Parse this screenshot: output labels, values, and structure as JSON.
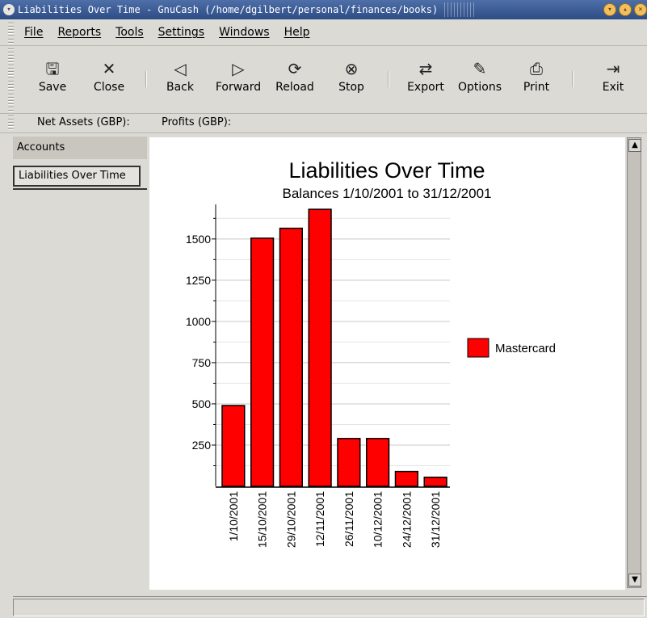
{
  "window": {
    "title": "Liabilities Over Time - GnuCash (/home/dgilbert/personal/finances/books)"
  },
  "menubar": {
    "items": [
      "File",
      "Reports",
      "Tools",
      "Settings",
      "Windows",
      "Help"
    ]
  },
  "toolbar": {
    "save": {
      "label": "Save",
      "icon": "floppy-disk-icon"
    },
    "close": {
      "label": "Close",
      "icon": "close-x-icon"
    },
    "back": {
      "label": "Back",
      "icon": "triangle-left-icon"
    },
    "forward": {
      "label": "Forward",
      "icon": "triangle-right-icon"
    },
    "reload": {
      "label": "Reload",
      "icon": "reload-icon"
    },
    "stop": {
      "label": "Stop",
      "icon": "stop-icon"
    },
    "export": {
      "label": "Export",
      "icon": "export-icon"
    },
    "options": {
      "label": "Options",
      "icon": "options-icon"
    },
    "print": {
      "label": "Print",
      "icon": "printer-icon"
    },
    "exit": {
      "label": "Exit",
      "icon": "exit-icon"
    }
  },
  "summary": {
    "net_assets": "Net Assets (GBP):",
    "profits": "Profits (GBP):"
  },
  "tabs": {
    "accounts": "Accounts",
    "liabilities": "Liabilities Over Time"
  },
  "colors": {
    "bar": "#ff0000",
    "titlebar": "#2d4c86"
  },
  "chart_data": {
    "type": "bar",
    "title": "Liabilities Over Time",
    "subtitle": "Balances 1/10/2001 to 31/12/2001",
    "categories": [
      "1/10/2001",
      "15/10/2001",
      "29/10/2001",
      "12/11/2001",
      "26/11/2001",
      "10/12/2001",
      "24/12/2001",
      "31/12/2001"
    ],
    "series": [
      {
        "name": "Mastercard",
        "values": [
          490,
          1505,
          1565,
          1680,
          290,
          290,
          90,
          55
        ]
      }
    ],
    "yticks": [
      250,
      500,
      750,
      1000,
      1250,
      1500
    ],
    "ylim": [
      0,
      1700
    ],
    "grid": true,
    "legend": "right"
  }
}
